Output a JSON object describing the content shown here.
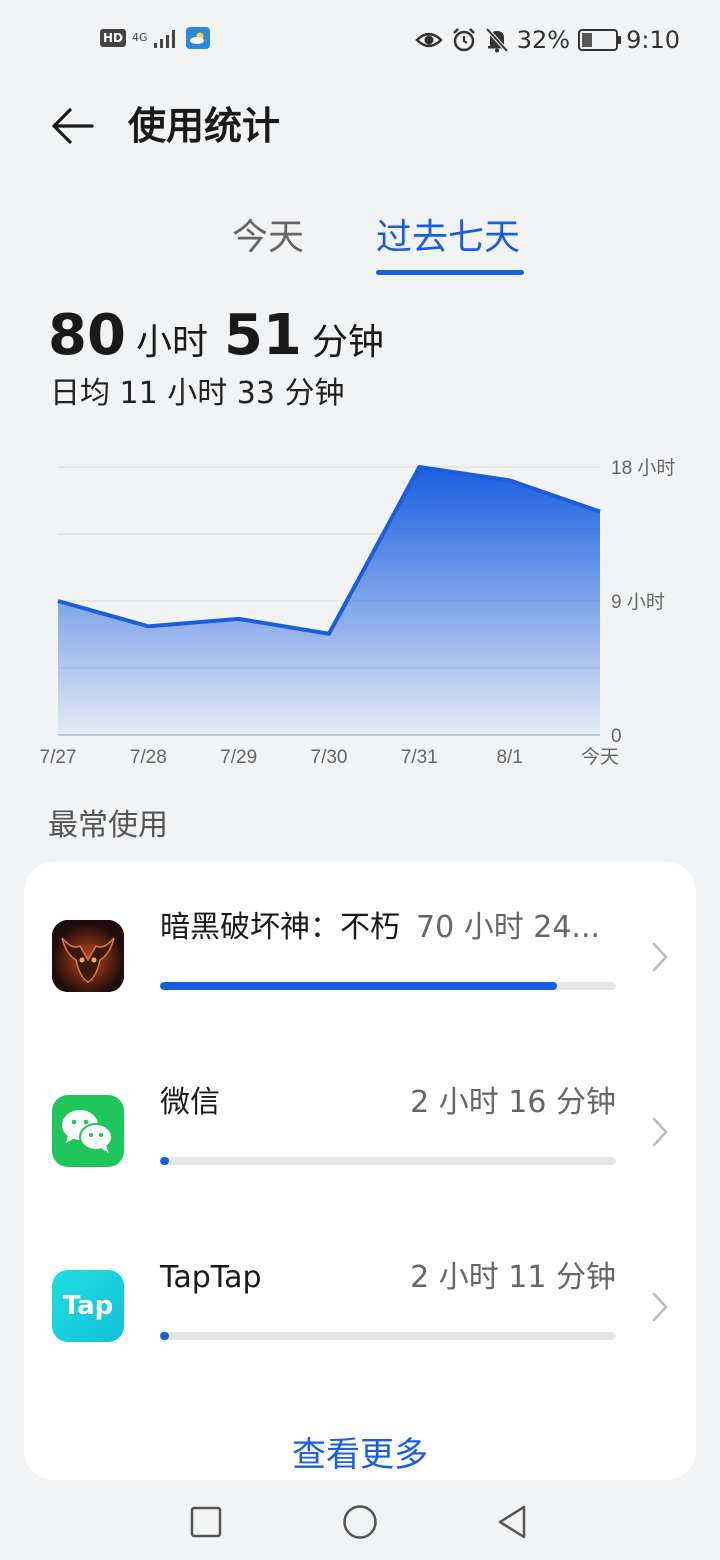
{
  "status_bar": {
    "hd_label": "HD",
    "network_label": "4G",
    "battery_percent": "32%",
    "battery_level": 0.32,
    "time": "9:10",
    "icons": [
      "eye-icon",
      "alarm-icon",
      "bell-off-icon",
      "battery-icon",
      "signal-icon",
      "weather-icon"
    ]
  },
  "header": {
    "title": "使用统计",
    "back_icon": "arrow-left-icon"
  },
  "tabs": [
    {
      "label": "今天",
      "active": false
    },
    {
      "label": "过去七天",
      "active": true
    }
  ],
  "summary": {
    "total_hours": "80",
    "hours_unit": "小时",
    "total_minutes": "51",
    "minutes_unit": "分钟",
    "daily_average": "日均 11 小时 33 分钟"
  },
  "chart_data": {
    "type": "area",
    "categories": [
      "7/27",
      "7/28",
      "7/29",
      "7/30",
      "7/31",
      "8/1",
      "今天"
    ],
    "values": [
      9.0,
      7.3,
      7.8,
      6.8,
      18.0,
      17.1,
      15.0
    ],
    "y_ticks": [
      {
        "value": 18,
        "label": "18 小时"
      },
      {
        "value": 9,
        "label": "9 小时"
      },
      {
        "value": 0,
        "label": "0"
      }
    ],
    "ylim": [
      0,
      18
    ],
    "grid": true,
    "color": "#1a5ee0"
  },
  "most_used": {
    "title": "最常使用",
    "apps": [
      {
        "name": "暗黑破坏神：不朽",
        "time": "70 小时 24...",
        "fraction": 0.87,
        "icon": "diablo-immortal-icon"
      },
      {
        "name": "微信",
        "time": "2 小时 16 分钟",
        "fraction": 0.01,
        "icon": "wechat-icon"
      },
      {
        "name": "TapTap",
        "time": "2 小时 11 分钟",
        "fraction": 0.01,
        "icon": "taptap-icon",
        "icon_text": "Tap"
      }
    ],
    "see_more": "查看更多"
  },
  "nav_bar": {
    "icons": [
      "recents-square-icon",
      "home-circle-icon",
      "back-triangle-icon"
    ]
  }
}
